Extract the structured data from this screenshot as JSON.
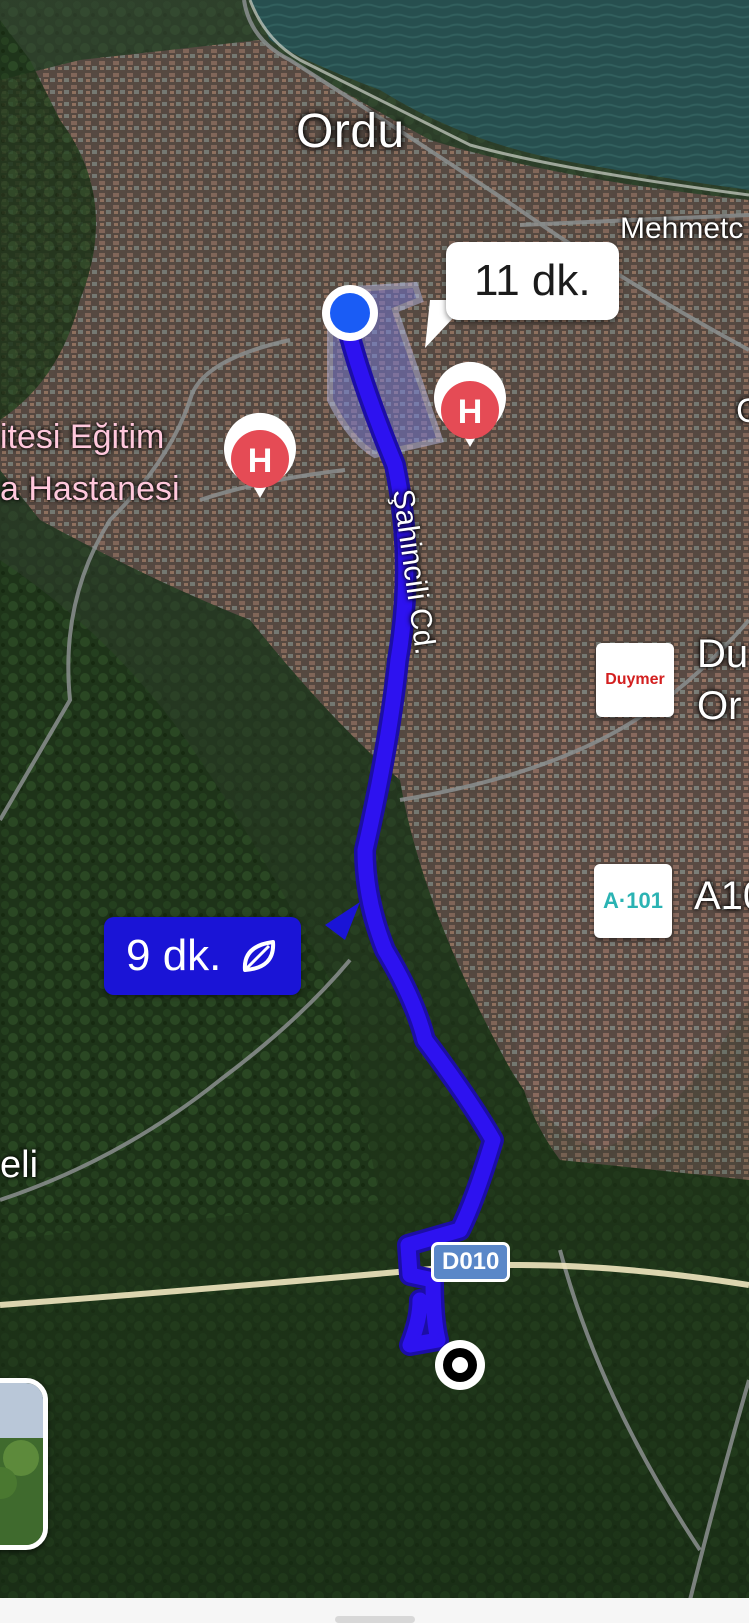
{
  "map": {
    "city_label": "Ordu",
    "street_mehmet": "Mehmetc",
    "road_sahincili": "Şahincili Cd.",
    "poi_hospital_left_line1": "itesi Eğitim",
    "poi_hospital_left_line2": "a Hastanesi",
    "poi_duymer_line1": "Du",
    "poi_duymer_line2": "Or",
    "poi_duymer_logo": "Duymer",
    "poi_a101_logo": "A·101",
    "poi_a101_label": "A10",
    "place_eli": "eli",
    "edge_letter": "C",
    "road_shield": "D010"
  },
  "routes": {
    "alt_duration": "11 dk.",
    "main_duration": "9 dk.",
    "main_icon": "leaf-icon"
  },
  "icons": {
    "hospital": "H"
  },
  "colors": {
    "route_main": "#2d12f0",
    "route_alt": "#aab0f5",
    "hospital_pin": "#e54b55",
    "origin_dot": "#1a5cf5",
    "shield": "#5a87c8"
  }
}
